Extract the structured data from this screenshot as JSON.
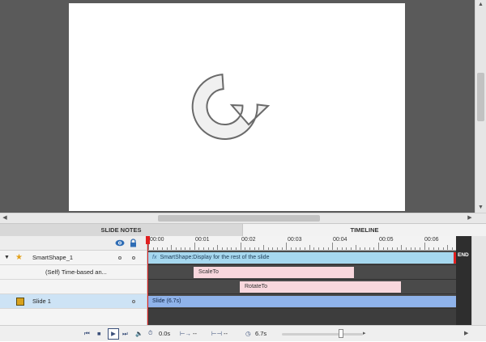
{
  "stage": {
    "shape_name": "rotate-arrow-shape"
  },
  "panels": {
    "slide_notes": "SLIDE NOTES",
    "timeline": "TIMELINE"
  },
  "ruler": {
    "ticks": [
      "00:00",
      "00:01",
      "00:02",
      "00:03",
      "00:04",
      "00:05",
      "00:06"
    ]
  },
  "layers": [
    {
      "name": "SmartShape_1",
      "type": "smartshape"
    },
    {
      "name": "(Self) Time-based an...",
      "type": "effect"
    },
    {
      "name": "",
      "type": "effect-sub"
    },
    {
      "name": "Slide 1",
      "type": "slide"
    }
  ],
  "bars": {
    "smartshape": "SmartShape:Display for the rest of the slide",
    "scale": "ScaleTo",
    "rotate": "RotateTo",
    "slide": "Slide (6.7s)"
  },
  "end_label": "END",
  "controls": {
    "time": "0.0s",
    "in_time": "--",
    "span_time": "--",
    "duration": "6.7s"
  },
  "colors": {
    "smartshape_bar": "#a6d8ef",
    "effect_bar": "#f8d7dd",
    "slide_bar": "#8fb3ea",
    "playhead": "#e02020"
  }
}
